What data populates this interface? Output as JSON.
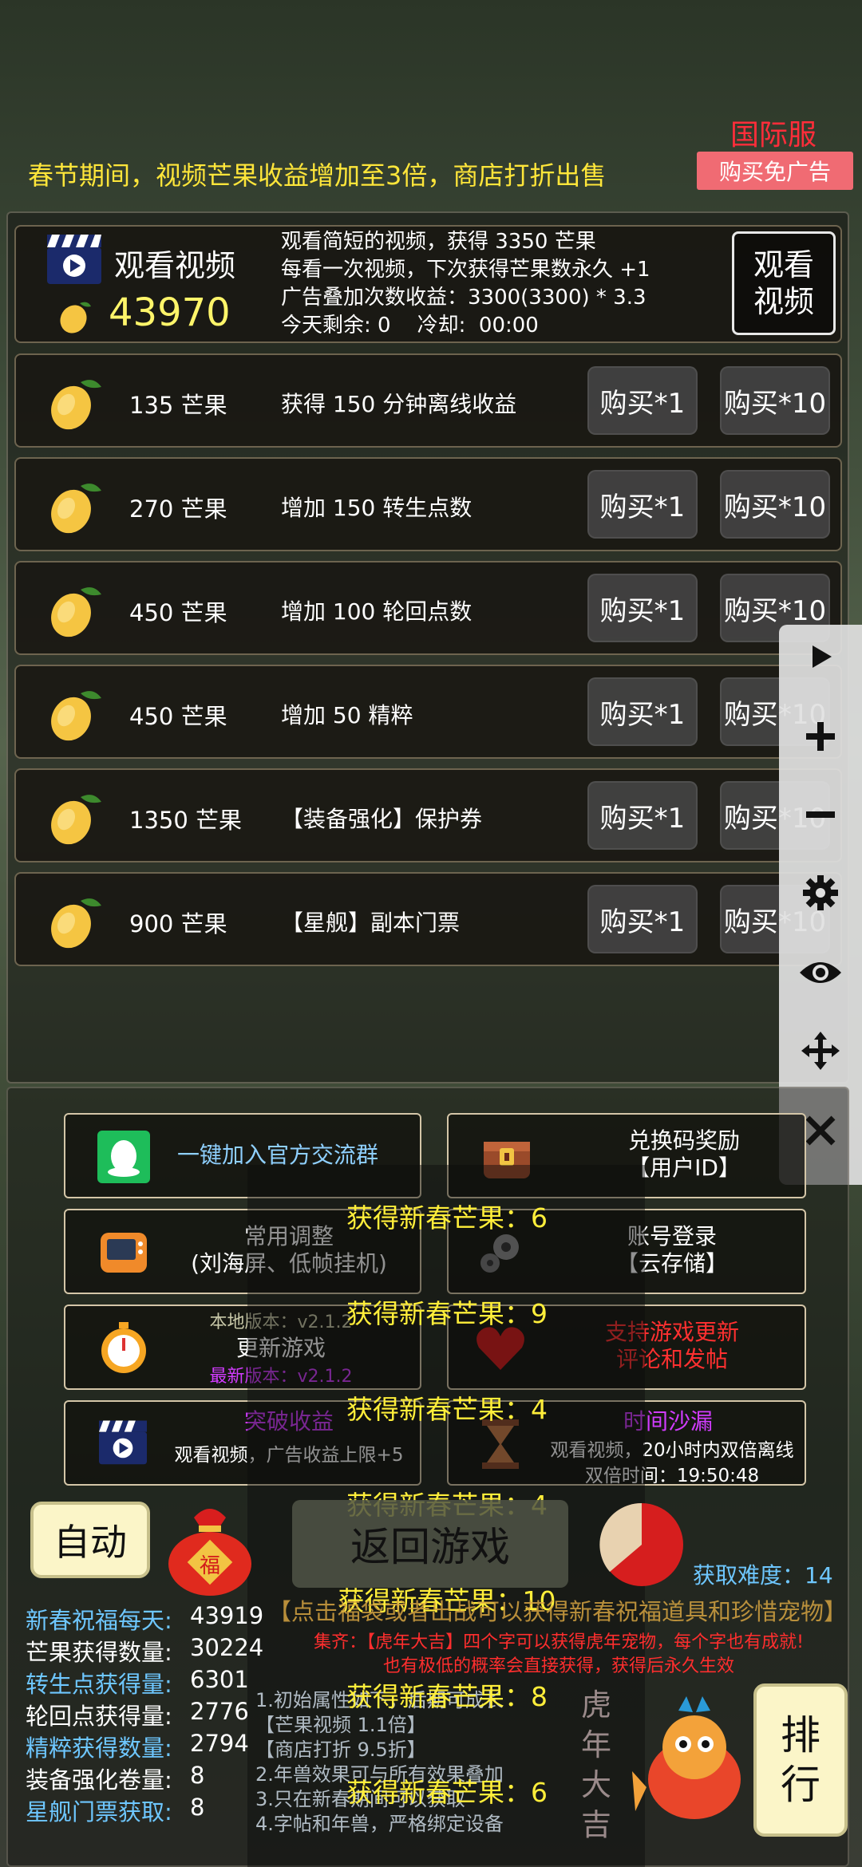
{
  "header": {
    "region": "国际服",
    "notice": "春节期间，视频芒果收益增加至3倍，商店打折出售",
    "no_ads_button": "购买免广告"
  },
  "video": {
    "title": "观看视频",
    "mango_total": "43970",
    "desc": [
      "观看简短的视频，获得 3350 芒果",
      "每看一次视频，下次获得芒果数永久 +1",
      "广告叠加次数收益：3300(3300) * 3.3",
      "今天剩余: 0    冷却:  00:00"
    ],
    "watch_button": "观看\n视频"
  },
  "shop_items": [
    {
      "price": "135 芒果",
      "desc": "获得 150 分钟离线收益",
      "buy1": "购买*1",
      "buy10": "购买*10"
    },
    {
      "price": "270 芒果",
      "desc": "增加 150 转生点数",
      "buy1": "购买*1",
      "buy10": "购买*10"
    },
    {
      "price": "450 芒果",
      "desc": "增加 100 轮回点数",
      "buy1": "购买*1",
      "buy10": "购买*10"
    },
    {
      "price": "450 芒果",
      "desc": "增加 50 精粹",
      "buy1": "购买*1",
      "buy10": "购买*10"
    },
    {
      "price": "1350 芒果",
      "desc": "【装备强化】保护券",
      "buy1": "购买*1",
      "buy10": "购买*10"
    },
    {
      "price": "900 芒果",
      "desc": "【星舰】副本门票",
      "buy1": "购买*1",
      "buy10": "购买*10"
    }
  ],
  "toolbar_icons": [
    "play-icon",
    "plus-icon",
    "minus-icon",
    "gear-icon",
    "eye-icon",
    "move-icon",
    "close-icon"
  ],
  "menu": {
    "join_group": "一键加入官方交流群",
    "redeem_line1": "兑换码奖励",
    "redeem_line2": "【用户ID】",
    "common_line1": "常用调整",
    "common_line2": "(刘海屏、低帧挂机)",
    "login_line1": "账号登录",
    "login_line2": "【云存储】",
    "local_version": "本地版本：v2.1.2",
    "update_game": "更新游戏",
    "latest_version": "最新版本：v2.1.2",
    "support_line1": "支持游戏更新",
    "support_line2": "评论和发帖",
    "breakthrough_title": "突破收益",
    "breakthrough_desc": "观看视频，广告收益上限+5",
    "hourglass_title": "时间沙漏",
    "hourglass_desc": "观看视频，20小时内双倍离线",
    "double_time": "双倍时间：19:50:48"
  },
  "rewards": [
    "获得新春芒果：6",
    "获得新春芒果：9",
    "获得新春芒果：4",
    "获得新春芒果：4",
    "获得新春芒果：10",
    "获得新春芒果：8",
    "获得新春芒果：6"
  ],
  "controls": {
    "auto": "自动",
    "fu_char": "福",
    "back": "返回游戏",
    "difficulty": "获取难度：14",
    "promo": "【点击福袋或者出战可以获得新春祝福道具和珍惜宠物】",
    "red_line1": "集齐：【虎年大吉】四个字可以获得虎年宠物，每个字也有成就!",
    "red_line2": "也有极低的概率会直接获得，获得后永久生效",
    "rank": "排\n行"
  },
  "stats": [
    {
      "label": "新春祝福每天:",
      "value": "43919"
    },
    {
      "label": "芒果获得数量:",
      "value": "30224"
    },
    {
      "label": "转生点获得量:",
      "value": "6301"
    },
    {
      "label": "轮回点获得量:",
      "value": "2776"
    },
    {
      "label": "精粹获得数量:",
      "value": "2794"
    },
    {
      "label": "装备强化卷量:",
      "value": "8"
    },
    {
      "label": "星舰门票获取:",
      "value": "8"
    }
  ],
  "notes": [
    "1.初始属性如下，后期可成长",
    "【芒果视频 1.1倍】",
    "【商店打折 9.5折】",
    "2.年兽效果可与所有效果叠加",
    "3.只在新春期间可以获取",
    "4.字帖和年兽，严格绑定设备"
  ],
  "tiger_text": "虎\n年\n大\n吉"
}
